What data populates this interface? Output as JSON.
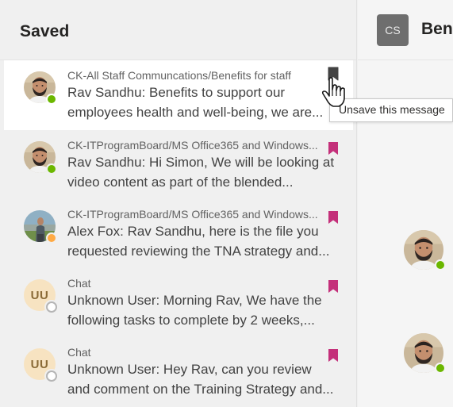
{
  "saved_panel": {
    "title": "Saved",
    "tooltip": "Unsave this message",
    "items": [
      {
        "channel": "CK-All Staff Communcations/Benefits for staff",
        "message": "Rav Sandhu: Benefits to support our employees health and well-being, we are...",
        "avatar": "photo-man-beard",
        "status": "available",
        "bookmark_color": "#424242",
        "active": true
      },
      {
        "channel": "CK-ITProgramBoard/MS Office365 and Windows...",
        "message": "Rav Sandhu: Hi Simon, We will be looking at video content as part of the blended...",
        "avatar": "photo-man-beard",
        "status": "available",
        "bookmark_color": "#c4307a"
      },
      {
        "channel": "CK-ITProgramBoard/MS Office365 and Windows...",
        "message": "Alex Fox: Rav Sandhu, here is the file you requested reviewing the TNA strategy and...",
        "avatar": "photo-man-outdoor",
        "status": "away",
        "bookmark_color": "#c4307a"
      },
      {
        "channel": "Chat",
        "message": "Unknown User: Morning Rav, We have the following tasks to complete by 2 weeks,...",
        "avatar_initials": "UU",
        "status": "offline",
        "bookmark_color": "#c4307a"
      },
      {
        "channel": "Chat",
        "message": "Unknown User: Hey Rav, can you review and comment on the Training Strategy and...",
        "avatar_initials": "UU",
        "status": "offline",
        "bookmark_color": "#c4307a"
      }
    ]
  },
  "conversation": {
    "avatar_initials": "CS",
    "title": "Ben",
    "message_avatars": [
      "photo-man-beard",
      "photo-man-beard"
    ]
  }
}
